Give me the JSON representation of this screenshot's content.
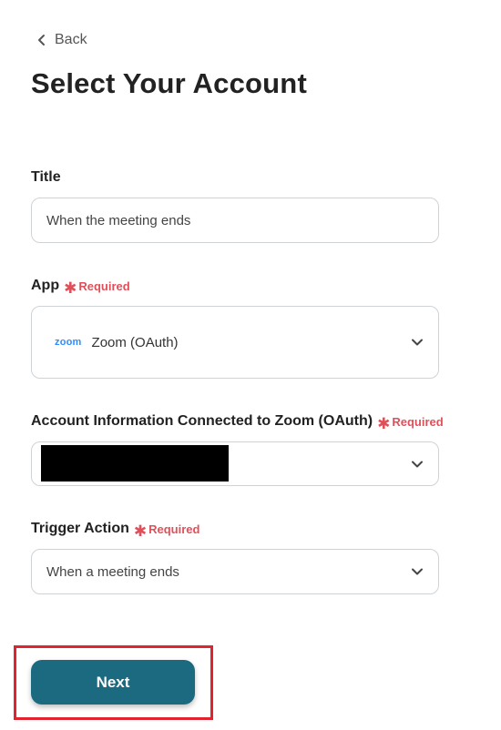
{
  "back": {
    "label": "Back"
  },
  "page": {
    "title": "Select Your Account"
  },
  "required_label": "Required",
  "fields": {
    "title": {
      "label": "Title",
      "value": "When the meeting ends"
    },
    "app": {
      "label": "App",
      "logo_text": "zoom",
      "value": "Zoom (OAuth)"
    },
    "account": {
      "label": "Account Information Connected to Zoom (OAuth)"
    },
    "trigger": {
      "label": "Trigger Action",
      "value": "When a meeting ends"
    }
  },
  "next_button": {
    "label": "Next"
  },
  "colors": {
    "primary": "#1b6a80",
    "required": "#e0505a",
    "highlight": "#e0232e",
    "zoom_brand": "#2d8cff"
  }
}
